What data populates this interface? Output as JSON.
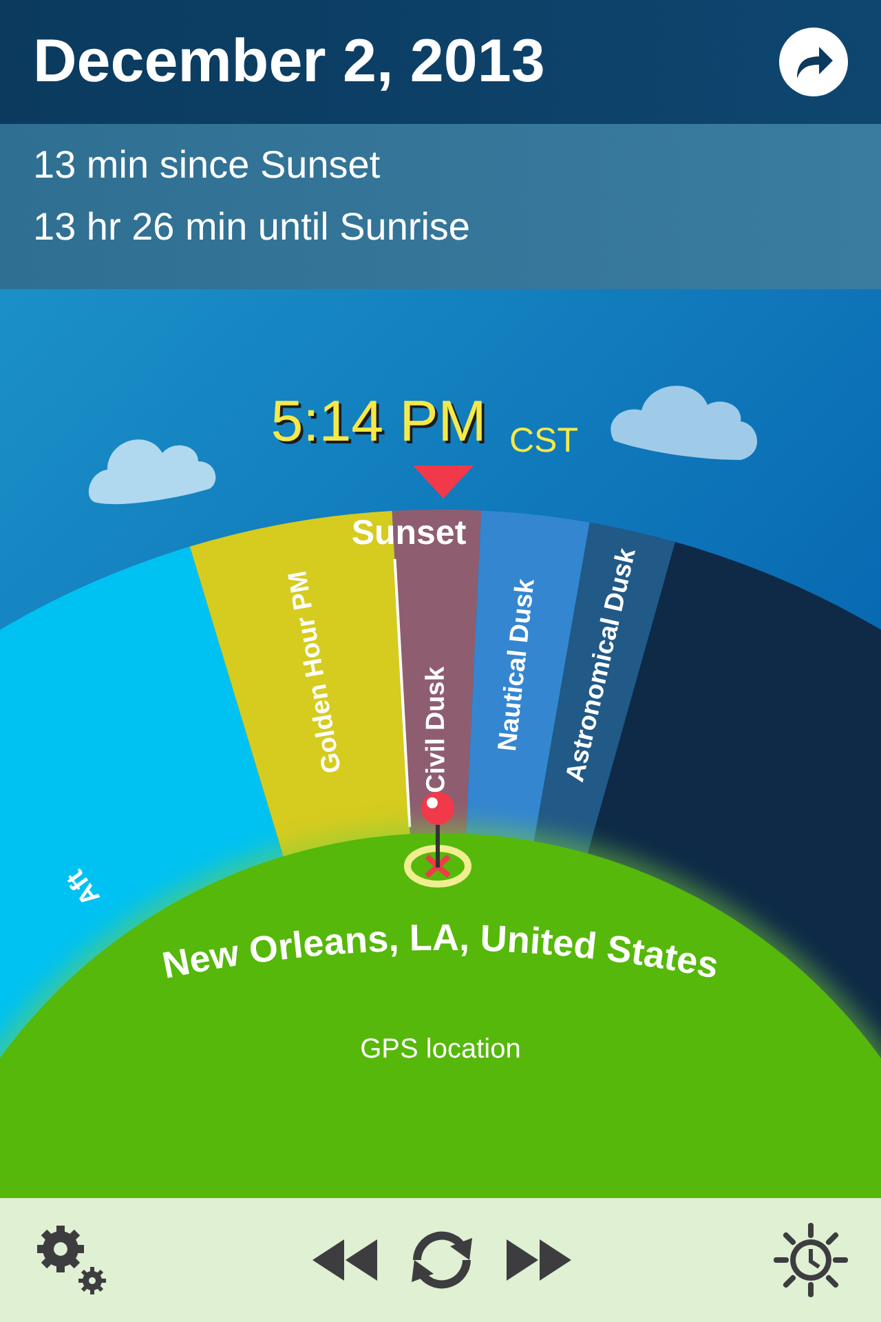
{
  "header": {
    "date": "December 2, 2013"
  },
  "info": [
    "13 min since Sunset",
    "13 hr 26 min until Sunrise"
  ],
  "clock": {
    "time": "5:14 PM",
    "zone": "CST"
  },
  "event": {
    "label": "Sunset"
  },
  "segments": [
    {
      "label": "Aft",
      "color": "#00c2f2"
    },
    {
      "label": "Golden Hour PM",
      "color": "#d6cb1f"
    },
    {
      "label": "Civil Dusk",
      "color": "#8e5e70"
    },
    {
      "label": "Nautical Dusk",
      "color": "#3486d0"
    },
    {
      "label": "Astronomical Dusk",
      "color": "#215987"
    },
    {
      "color": "#0e2a47"
    }
  ],
  "location": {
    "name": "New Orleans, LA, United States",
    "source": "GPS location"
  }
}
